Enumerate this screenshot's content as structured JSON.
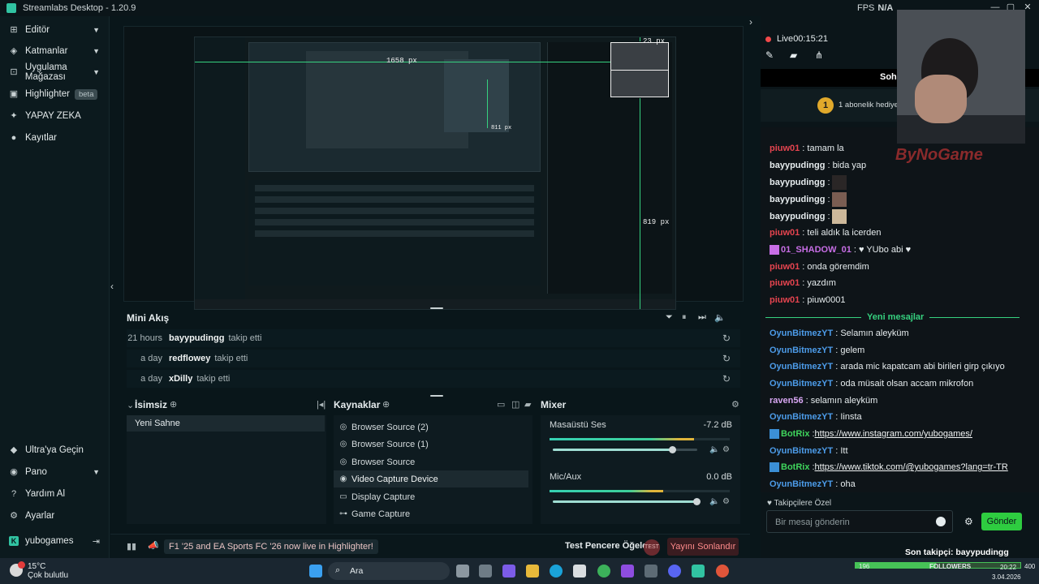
{
  "window": {
    "title": "Streamlabs Desktop - 1.20.9",
    "fps_label": "FPS",
    "fps_value": "N/A"
  },
  "sidebar": {
    "items": [
      {
        "label": "Editör",
        "icon": "editor-icon"
      },
      {
        "label": "Katmanlar",
        "icon": "layers-icon"
      },
      {
        "label": "Uygulama Mağazası",
        "icon": "store-icon"
      },
      {
        "label": "Highlighter",
        "icon": "highlighter-icon",
        "badge": "beta"
      },
      {
        "label": "YAPAY ZEKA",
        "icon": "ai-sparkle-icon"
      },
      {
        "label": "Kayıtlar",
        "icon": "recordings-icon"
      }
    ],
    "bottom": [
      {
        "label": "Ultra'ya Geçin",
        "icon": "ultra-icon"
      },
      {
        "label": "Pano",
        "icon": "dashboard-icon"
      },
      {
        "label": "Yardım Al",
        "icon": "help-icon"
      },
      {
        "label": "Ayarlar",
        "icon": "settings-gear-icon"
      },
      {
        "label": "yubogames",
        "icon": "kick-icon"
      }
    ]
  },
  "preview": {
    "guide_labels": [
      "1658 px",
      "23 px",
      "811 px",
      "819 px"
    ]
  },
  "mini_feed": {
    "title": "Mini Akış",
    "events": [
      {
        "when": "21 hours",
        "user": "bayypudingg",
        "action": "takip etti"
      },
      {
        "when": "a day",
        "user": "redflowey",
        "action": "takip etti"
      },
      {
        "when": "a day",
        "user": "xDilly",
        "action": "takip etti"
      }
    ]
  },
  "scenes": {
    "title": "İsimsiz",
    "items": [
      "Yeni Sahne"
    ]
  },
  "sources": {
    "title": "Kaynaklar",
    "items": [
      {
        "label": "Browser Source (2)",
        "icon": "globe-icon"
      },
      {
        "label": "Browser Source (1)",
        "icon": "globe-icon"
      },
      {
        "label": "Browser Source",
        "icon": "globe-icon"
      },
      {
        "label": "Video Capture Device",
        "icon": "webcam-icon",
        "selected": true
      },
      {
        "label": "Display Capture",
        "icon": "monitor-icon"
      },
      {
        "label": "Game Capture",
        "icon": "gamepad-icon"
      }
    ]
  },
  "mixer": {
    "title": "Mixer",
    "channels": [
      {
        "name": "Masaüstü Ses",
        "db": "-7.2 dB",
        "meter_level": 0.8,
        "volume": 0.83
      },
      {
        "name": "Mic/Aux",
        "db": "0.0 dB",
        "meter_level": 0.63,
        "volume": 1.0
      }
    ]
  },
  "footer": {
    "news": "F1 '25 and EA Sports FC '26 now live in Highlighter!",
    "test_label": "Test Pencere Öğeleri",
    "test_toggle": "TEST",
    "end_stream": "Yayını Sonlandır"
  },
  "chat": {
    "live_label": "Live",
    "live_time": "00:15:21",
    "header": "Sohb",
    "sub_banner": "1 abonelik hediye e",
    "sub_badge": "1",
    "new_messages_label": "Yeni mesajlar",
    "messages": [
      {
        "user": "piuw01",
        "color": "#e5444f",
        "text": ": tamam la"
      },
      {
        "user": "bayypudingg",
        "color": "#e6ecee",
        "text": ": bida yap"
      },
      {
        "user": "bayypudingg",
        "color": "#e6ecee",
        "text": ":",
        "emote": true
      },
      {
        "user": "bayypudingg",
        "color": "#e6ecee",
        "text": ":",
        "emote": true
      },
      {
        "user": "bayypudingg",
        "color": "#e6ecee",
        "text": ":",
        "emote": true
      },
      {
        "user": "piuw01",
        "color": "#e5444f",
        "text": ": teli aldık la icerden"
      },
      {
        "user": "01_SHADOW_01",
        "color": "#c86ee6",
        "text": ": ♥ YUbo abi ♥"
      },
      {
        "user": "piuw01",
        "color": "#e5444f",
        "text": ": onda göremdim"
      },
      {
        "user": "piuw01",
        "color": "#e5444f",
        "text": ": yazdım"
      },
      {
        "user": "piuw01",
        "color": "#e5444f",
        "text": ": piuw0001"
      },
      {
        "user": "OyunBitmezYT",
        "color": "#4c9be8",
        "text": ": Selamın aleyküm"
      },
      {
        "user": "OyunBitmezYT",
        "color": "#4c9be8",
        "text": ": gelem"
      },
      {
        "user": "OyunBitmezYT",
        "color": "#4c9be8",
        "text": ": arada mic kapatcam abi birileri girp çıkıyo"
      },
      {
        "user": "OyunBitmezYT",
        "color": "#4c9be8",
        "text": ": oda müsait olsan accam mikrofon"
      },
      {
        "user": "raven56",
        "color": "#d7a6f2",
        "text": ": selamın aleyküm"
      },
      {
        "user": "OyunBitmezYT",
        "color": "#4c9be8",
        "text": ": Iinsta"
      },
      {
        "user": "BotRix",
        "color": "#3fd45c",
        "text": ": ",
        "link": "https://www.instagram.com/yubogames/"
      },
      {
        "user": "OyunBitmezYT",
        "color": "#4c9be8",
        "text": ": Itt"
      },
      {
        "user": "BotRix",
        "color": "#3fd45c",
        "text": ": ",
        "link": "https://www.tiktok.com/@yubogames?lang=tr-TR"
      },
      {
        "user": "OyunBitmezYT",
        "color": "#4c9be8",
        "text": ": oha"
      }
    ],
    "followers_only": "Takipçilere Özel",
    "input_placeholder": "Bir mesaj gönderin",
    "send_label": "Gönder",
    "last_follower": "Son takipçi: bayypudingg",
    "watermark": "ByNoGame"
  },
  "taskbar": {
    "weather_temp": "15°C",
    "weather_desc": "Çok bulutlu",
    "search_label": "Ara",
    "time": "20:22",
    "date": "3.04.2026",
    "followers_label": "FOLLOWERS",
    "followers_current": "196",
    "followers_goal": "400",
    "followers_progress": 0.49
  },
  "colors": {
    "accent": "#31c3a2",
    "live": "#f2494a",
    "send": "#2ecc40",
    "end_stream": "#ff8b8b"
  }
}
